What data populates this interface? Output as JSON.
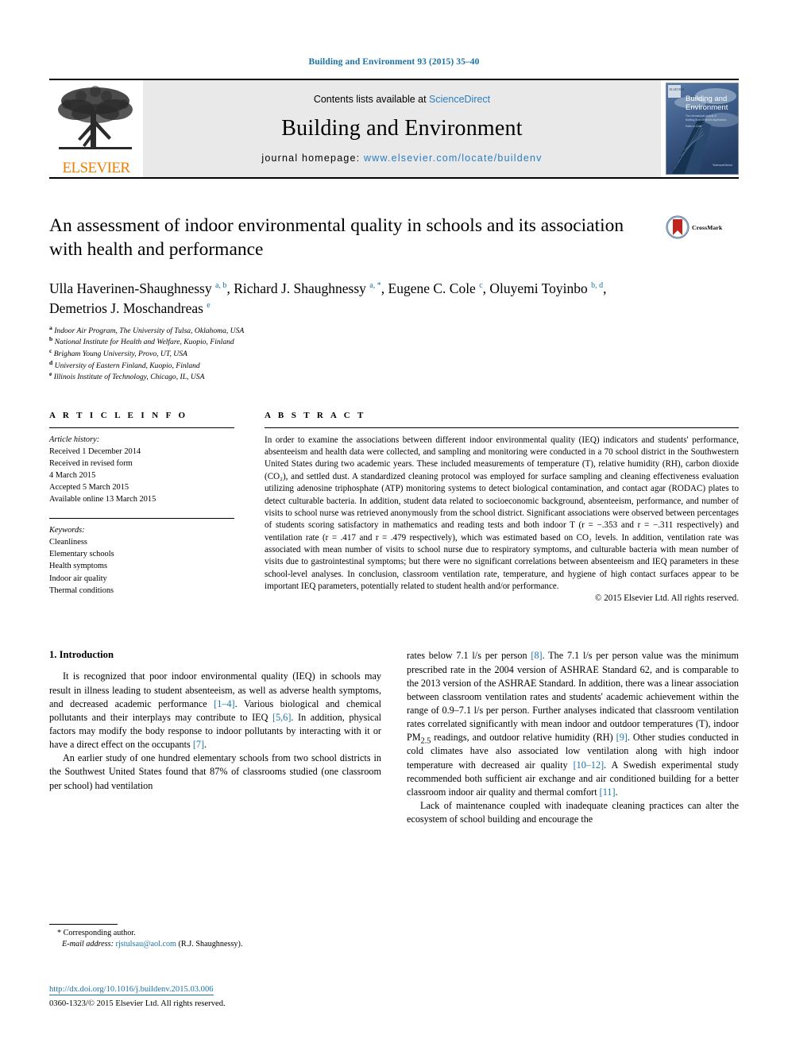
{
  "running_head": "Building and Environment 93 (2015) 35–40",
  "masthead": {
    "publisher_name": "ELSEVIER",
    "contents_prefix": "Contents lists available at ",
    "contents_link": "ScienceDirect",
    "journal_title": "Building and Environment",
    "homepage_prefix": "journal homepage: ",
    "homepage_url": "www.elsevier.com/locate/buildenv",
    "cover_title_line1": "Building and",
    "cover_title_line2": "Environment",
    "link_color": "#2b7dc0"
  },
  "article": {
    "title": "An assessment of indoor environmental quality in schools and its association with health and performance",
    "crossmark_label": "CrossMark",
    "authors_html": "Ulla Haverinen-Shaughnessy <sup>a, b</sup>, Richard J. Shaughnessy <sup>a, *</sup>, Eugene C. Cole <sup>c</sup>, Oluyemi Toyinbo <sup>b, d</sup>, Demetrios J. Moschandreas <sup>e</sup>",
    "affiliations": [
      {
        "marker": "a",
        "text": "Indoor Air Program, The University of Tulsa, Oklahoma, USA"
      },
      {
        "marker": "b",
        "text": "National Institute for Health and Welfare, Kuopio, Finland"
      },
      {
        "marker": "c",
        "text": "Brigham Young University, Provo, UT, USA"
      },
      {
        "marker": "d",
        "text": "University of Eastern Finland, Kuopio, Finland"
      },
      {
        "marker": "e",
        "text": "Illinois Institute of Technology, Chicago, IL, USA"
      }
    ]
  },
  "article_info": {
    "heading": "A R T I C L E  I N F O",
    "history_label": "Article history:",
    "history": [
      "Received 1 December 2014",
      "Received in revised form",
      "4 March 2015",
      "Accepted 5 March 2015",
      "Available online 13 March 2015"
    ],
    "keywords_label": "Keywords:",
    "keywords": [
      "Cleanliness",
      "Elementary schools",
      "Health symptoms",
      "Indoor air quality",
      "Thermal conditions"
    ]
  },
  "abstract": {
    "heading": "A B S T R A C T",
    "text": "In order to examine the associations between different indoor environmental quality (IEQ) indicators and students' performance, absenteeism and health data were collected, and sampling and monitoring were conducted in a 70 school district in the Southwestern United States during two academic years. These included measurements of temperature (T), relative humidity (RH), carbon dioxide (CO₂), and settled dust. A standardized cleaning protocol was employed for surface sampling and cleaning effectiveness evaluation utilizing adenosine triphosphate (ATP) monitoring systems to detect biological contamination, and contact agar (RODAC) plates to detect culturable bacteria. In addition, student data related to socioeconomic background, absenteeism, performance, and number of visits to school nurse was retrieved anonymously from the school district. Significant associations were observed between percentages of students scoring satisfactory in mathematics and reading tests and both indoor T (r = −.353 and r = −.311 respectively) and ventilation rate (r = .417 and r = .479 respectively), which was estimated based on CO₂ levels. In addition, ventilation rate was associated with mean number of visits to school nurse due to respiratory symptoms, and culturable bacteria with mean number of visits due to gastrointestinal symptoms; but there were no significant correlations between absenteeism and IEQ parameters in these school-level analyses. In conclusion, classroom ventilation rate, temperature, and hygiene of high contact surfaces appear to be important IEQ parameters, potentially related to student health and/or performance.",
    "copyright": "© 2015 Elsevier Ltd. All rights reserved."
  },
  "introduction": {
    "section_number_title": "1. Introduction",
    "left_paragraphs": [
      "It is recognized that poor indoor environmental quality (IEQ) in schools may result in illness leading to student absenteeism, as well as adverse health symptoms, and decreased academic performance [1–4]. Various biological and chemical pollutants and their interplays may contribute to IEQ [5,6]. In addition, physical factors may modify the body response to indoor pollutants by interacting with it or have a direct effect on the occupants [7].",
      "An earlier study of one hundred elementary schools from two school districts in the Southwest United States found that 87% of classrooms studied (one classroom per school) had ventilation"
    ],
    "right_paragraphs": [
      "rates below 7.1 l/s per person [8]. The 7.1 l/s per person value was the minimum prescribed rate in the 2004 version of ASHRAE Standard 62, and is comparable to the 2013 version of the ASHRAE Standard. In addition, there was a linear association between classroom ventilation rates and students' academic achievement within the range of 0.9–7.1 l/s per person. Further analyses indicated that classroom ventilation rates correlated significantly with mean indoor and outdoor temperatures (T), indoor PM2.5 readings, and outdoor relative humidity (RH) [9]. Other studies conducted in cold climates have also associated low ventilation along with high indoor temperature with decreased air quality [10–12]. A Swedish experimental study recommended both sufficient air exchange and air conditioned building for a better classroom indoor air quality and thermal comfort [11].",
      "Lack of maintenance coupled with inadequate cleaning practices can alter the ecosystem of school building and encourage the"
    ]
  },
  "footnote": {
    "corresponding_author": "Corresponding author.",
    "email_label": "E-mail address:",
    "email": "rjstulsau@aol.com",
    "email_suffix": "(R.J. Shaughnessy)."
  },
  "footer": {
    "doi": "http://dx.doi.org/10.1016/j.buildenv.2015.03.006",
    "issn_copyright": "0360-1323/© 2015 Elsevier Ltd. All rights reserved."
  }
}
